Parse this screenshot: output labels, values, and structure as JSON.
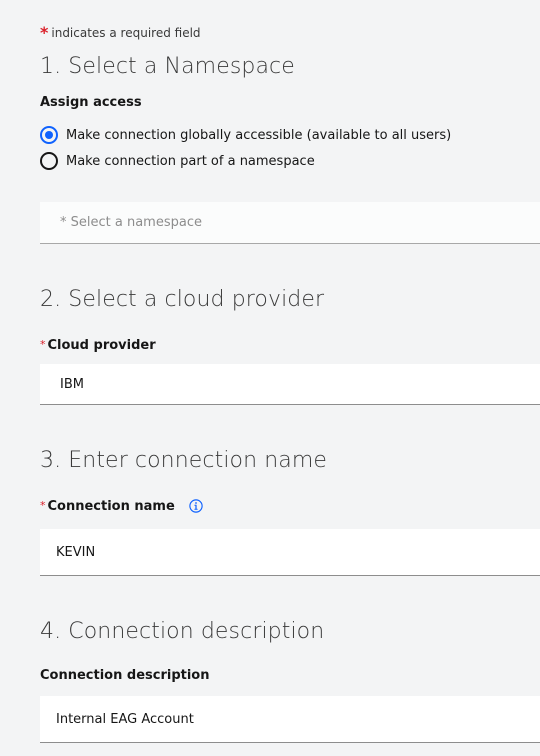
{
  "required_note": {
    "star": "*",
    "text": "indicates a required field"
  },
  "sections": {
    "namespace": {
      "heading": "1. Select a Namespace",
      "label": "Assign access",
      "options": [
        {
          "label": "Make connection globally accessible (available to all users)",
          "selected": true
        },
        {
          "label": "Make connection part of a namespace",
          "selected": false
        }
      ],
      "select_placeholder": "* Select a namespace"
    },
    "provider": {
      "heading": "2. Select a cloud provider",
      "label_star": "*",
      "label": "Cloud provider",
      "value": "IBM"
    },
    "name": {
      "heading": "3. Enter connection name",
      "label_star": "*",
      "label": "Connection name",
      "info_icon": "info-icon",
      "value": "KEVIN"
    },
    "description": {
      "heading": "4. Connection description",
      "label": "Connection description",
      "value": "Internal EAG Account"
    }
  },
  "colors": {
    "accent": "#0f62fe",
    "required": "#da1e28",
    "background": "#f3f4f5"
  }
}
